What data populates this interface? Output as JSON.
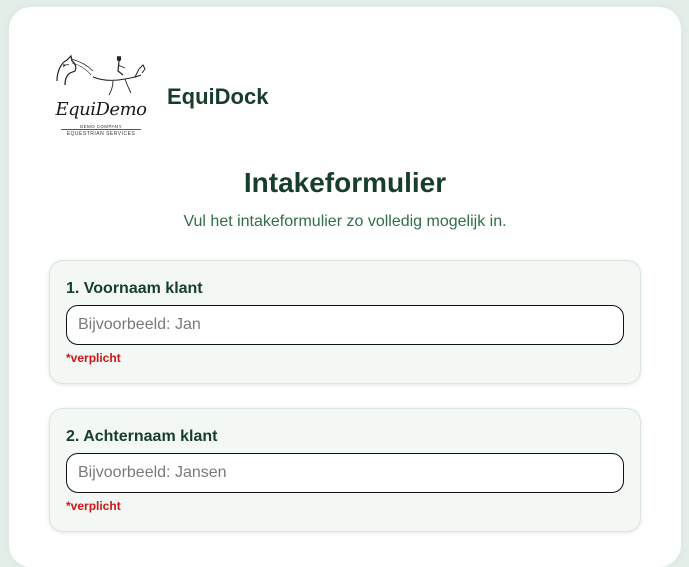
{
  "logo": {
    "name": "EquiDemo",
    "line1": "DEMO COMPANY",
    "line2": "EQUESTRIAN SERVICES"
  },
  "brand": "EquiDock",
  "title": "Intakeformulier",
  "subtitle": "Vul het intakeformulier zo volledig mogelijk in.",
  "fields": [
    {
      "label": "1. Voornaam klant",
      "placeholder": "Bijvoorbeeld: Jan",
      "value": "",
      "required_text": "*verplicht"
    },
    {
      "label": "2. Achternaam klant",
      "placeholder": "Bijvoorbeeld: Jansen",
      "value": "",
      "required_text": "*verplicht"
    }
  ],
  "colors": {
    "brand_green": "#173d2c",
    "subtitle_green": "#2f6e4a",
    "required_red": "#d01414",
    "page_background": "#e3eee8",
    "field_background": "#f3f8f5"
  }
}
